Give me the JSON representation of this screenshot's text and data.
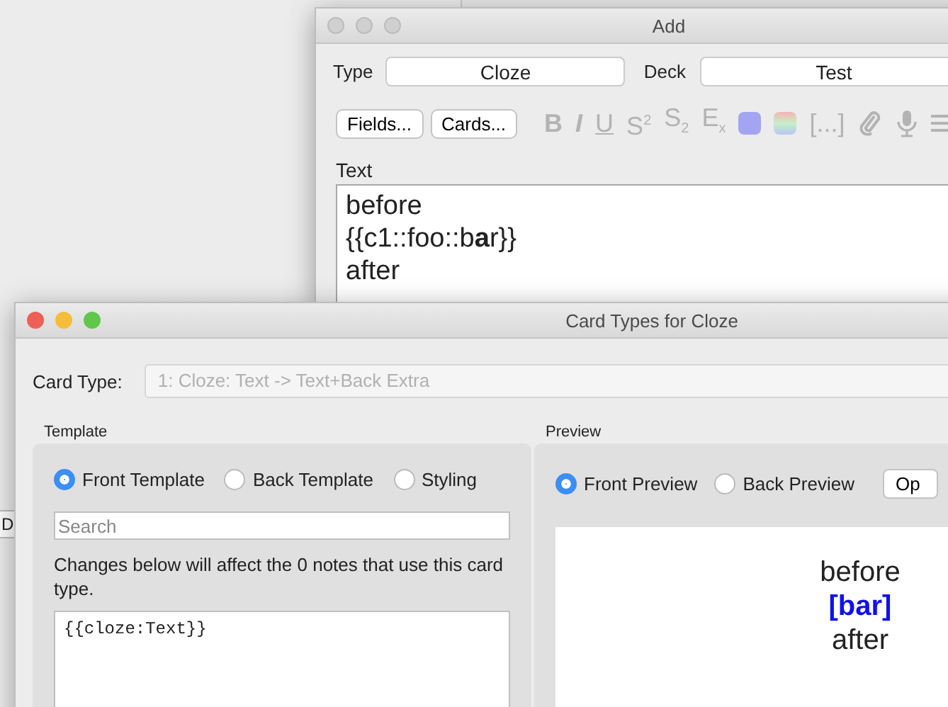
{
  "background_window": {
    "button": "D"
  },
  "add_window": {
    "title": "Add",
    "type_label": "Type",
    "type_value": "Cloze",
    "deck_label": "Deck",
    "deck_value": "Test",
    "buttons": [
      "Fields...",
      "Cards..."
    ],
    "toolbar": [
      {
        "kind": "glyph",
        "label": "B"
      },
      {
        "kind": "glyph",
        "label": "I"
      },
      {
        "kind": "glyph",
        "label": "U"
      },
      {
        "kind": "glyph",
        "label": "S$^{2}$"
      },
      {
        "kind": "glyph",
        "label": "S$_{2}$"
      },
      {
        "kind": "glyph",
        "label": "E$_{x}$"
      },
      {
        "kind": "swatch",
        "color": "#a3a5f2"
      },
      {
        "kind": "gradient"
      },
      {
        "kind": "glyph",
        "label": "[...]"
      },
      {
        "kind": "paperclip"
      },
      {
        "kind": "microphone"
      },
      {
        "kind": "menu"
      }
    ],
    "field_label": "Text",
    "field_lines": [
      "before",
      "{{c1::foo::b**a**r}}",
      "after"
    ]
  },
  "card_types_window": {
    "title": "Card Types for Cloze",
    "card_type_label": "Card Type:",
    "card_type_value": "1: Cloze: Text -> Text+Back Extra",
    "card_type_disabled": true,
    "template": {
      "heading": "Template",
      "radios": [
        {
          "label": "Front Template",
          "selected": true
        },
        {
          "label": "Back Template",
          "selected": false
        },
        {
          "label": "Styling",
          "selected": false
        }
      ],
      "search": {
        "placeholder": "Search"
      },
      "note": "Changes below will affect the 0 notes that use this card type.",
      "code": "{{cloze:Text}}"
    },
    "preview": {
      "heading": "Preview",
      "radios": [
        {
          "label": "Front Preview",
          "selected": true
        },
        {
          "label": "Back Preview",
          "selected": false
        }
      ],
      "button": "Op",
      "lines": [
        {
          "kind": "text",
          "text": "before"
        },
        {
          "kind": "cloze",
          "text": "[bar]"
        },
        {
          "kind": "text",
          "text": "after"
        }
      ]
    }
  }
}
